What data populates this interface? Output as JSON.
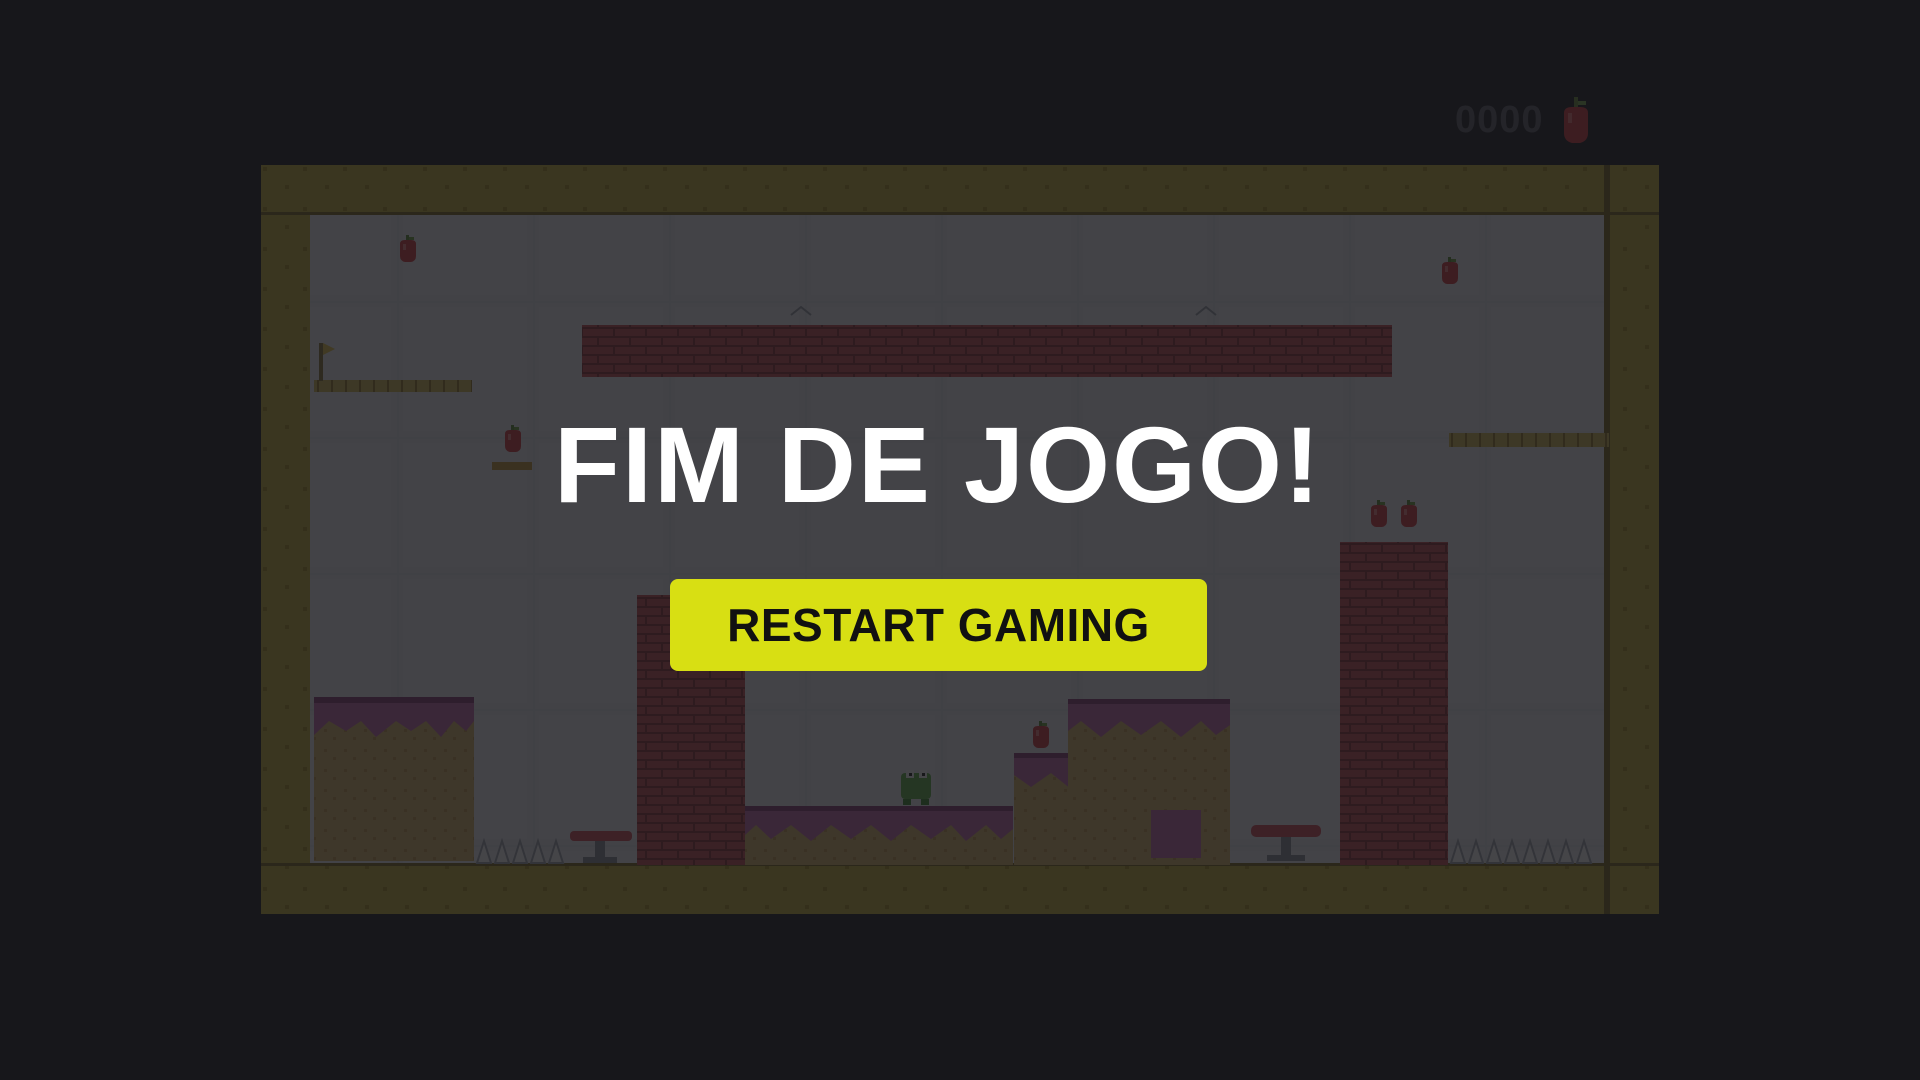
{
  "hud": {
    "score": "0000",
    "collectible_icon": "apple-icon"
  },
  "game_over": {
    "title": "FIM DE JOGO!",
    "restart_label": "RESTART GAMING"
  },
  "colors": {
    "background": "#1b1b1f",
    "button": "#d8df13",
    "button_text": "#111111",
    "title": "#ffffff",
    "frame": "#c9b53a",
    "brick": "#c0474e",
    "sky": "#eef1f6",
    "grass": "#c76ab0",
    "dirt": "#d9b469"
  }
}
